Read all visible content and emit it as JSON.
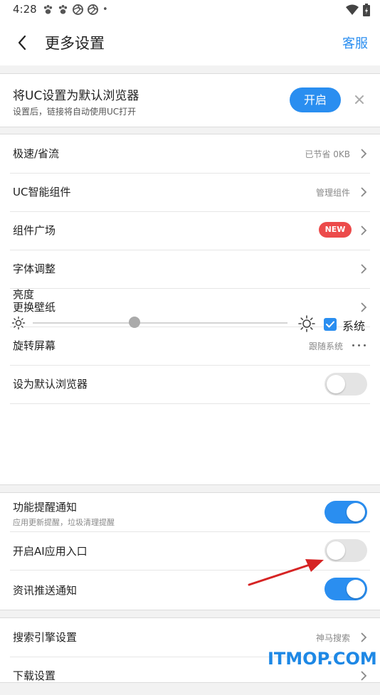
{
  "status_bar": {
    "time": "4:28",
    "notification_icons": [
      "paw-icon",
      "paw-icon",
      "aperture-icon",
      "aperture-icon"
    ],
    "dot": "•"
  },
  "app_bar": {
    "title": "更多设置",
    "service": "客服"
  },
  "banner": {
    "title": "将UC设置为默认浏览器",
    "subtitle": "设置后，链接将自动使用UC打开",
    "button": "开启"
  },
  "settings": [
    {
      "label": "极速/省流",
      "value": "已节省 0KB"
    },
    {
      "label": "UC智能组件",
      "value": "管理组件"
    },
    {
      "label": "组件广场",
      "badge": "NEW"
    },
    {
      "label": "字体调整"
    },
    {
      "label": "更换壁纸"
    },
    {
      "label": "旋转屏幕",
      "value": "跟随系统"
    },
    {
      "label": "设为默认浏览器",
      "toggle": false
    }
  ],
  "brightness": {
    "label": "亮度",
    "level": 0.4,
    "system_label": "系统",
    "system_checked": true
  },
  "notifications": [
    {
      "label": "功能提醒通知",
      "sub": "应用更新提醒，垃圾清理提醒",
      "toggle": true
    },
    {
      "label": "开启AI应用入口",
      "toggle": false
    },
    {
      "label": "资讯推送通知",
      "toggle": true
    }
  ],
  "more_settings": [
    {
      "label": "搜索引擎设置",
      "value": "神马搜索"
    },
    {
      "label": "下载设置"
    }
  ],
  "watermark": "ITMOP.COM",
  "colors": {
    "accent": "#2a8ef0",
    "badge": "#ec4b4b",
    "arrow": "#d62424"
  }
}
